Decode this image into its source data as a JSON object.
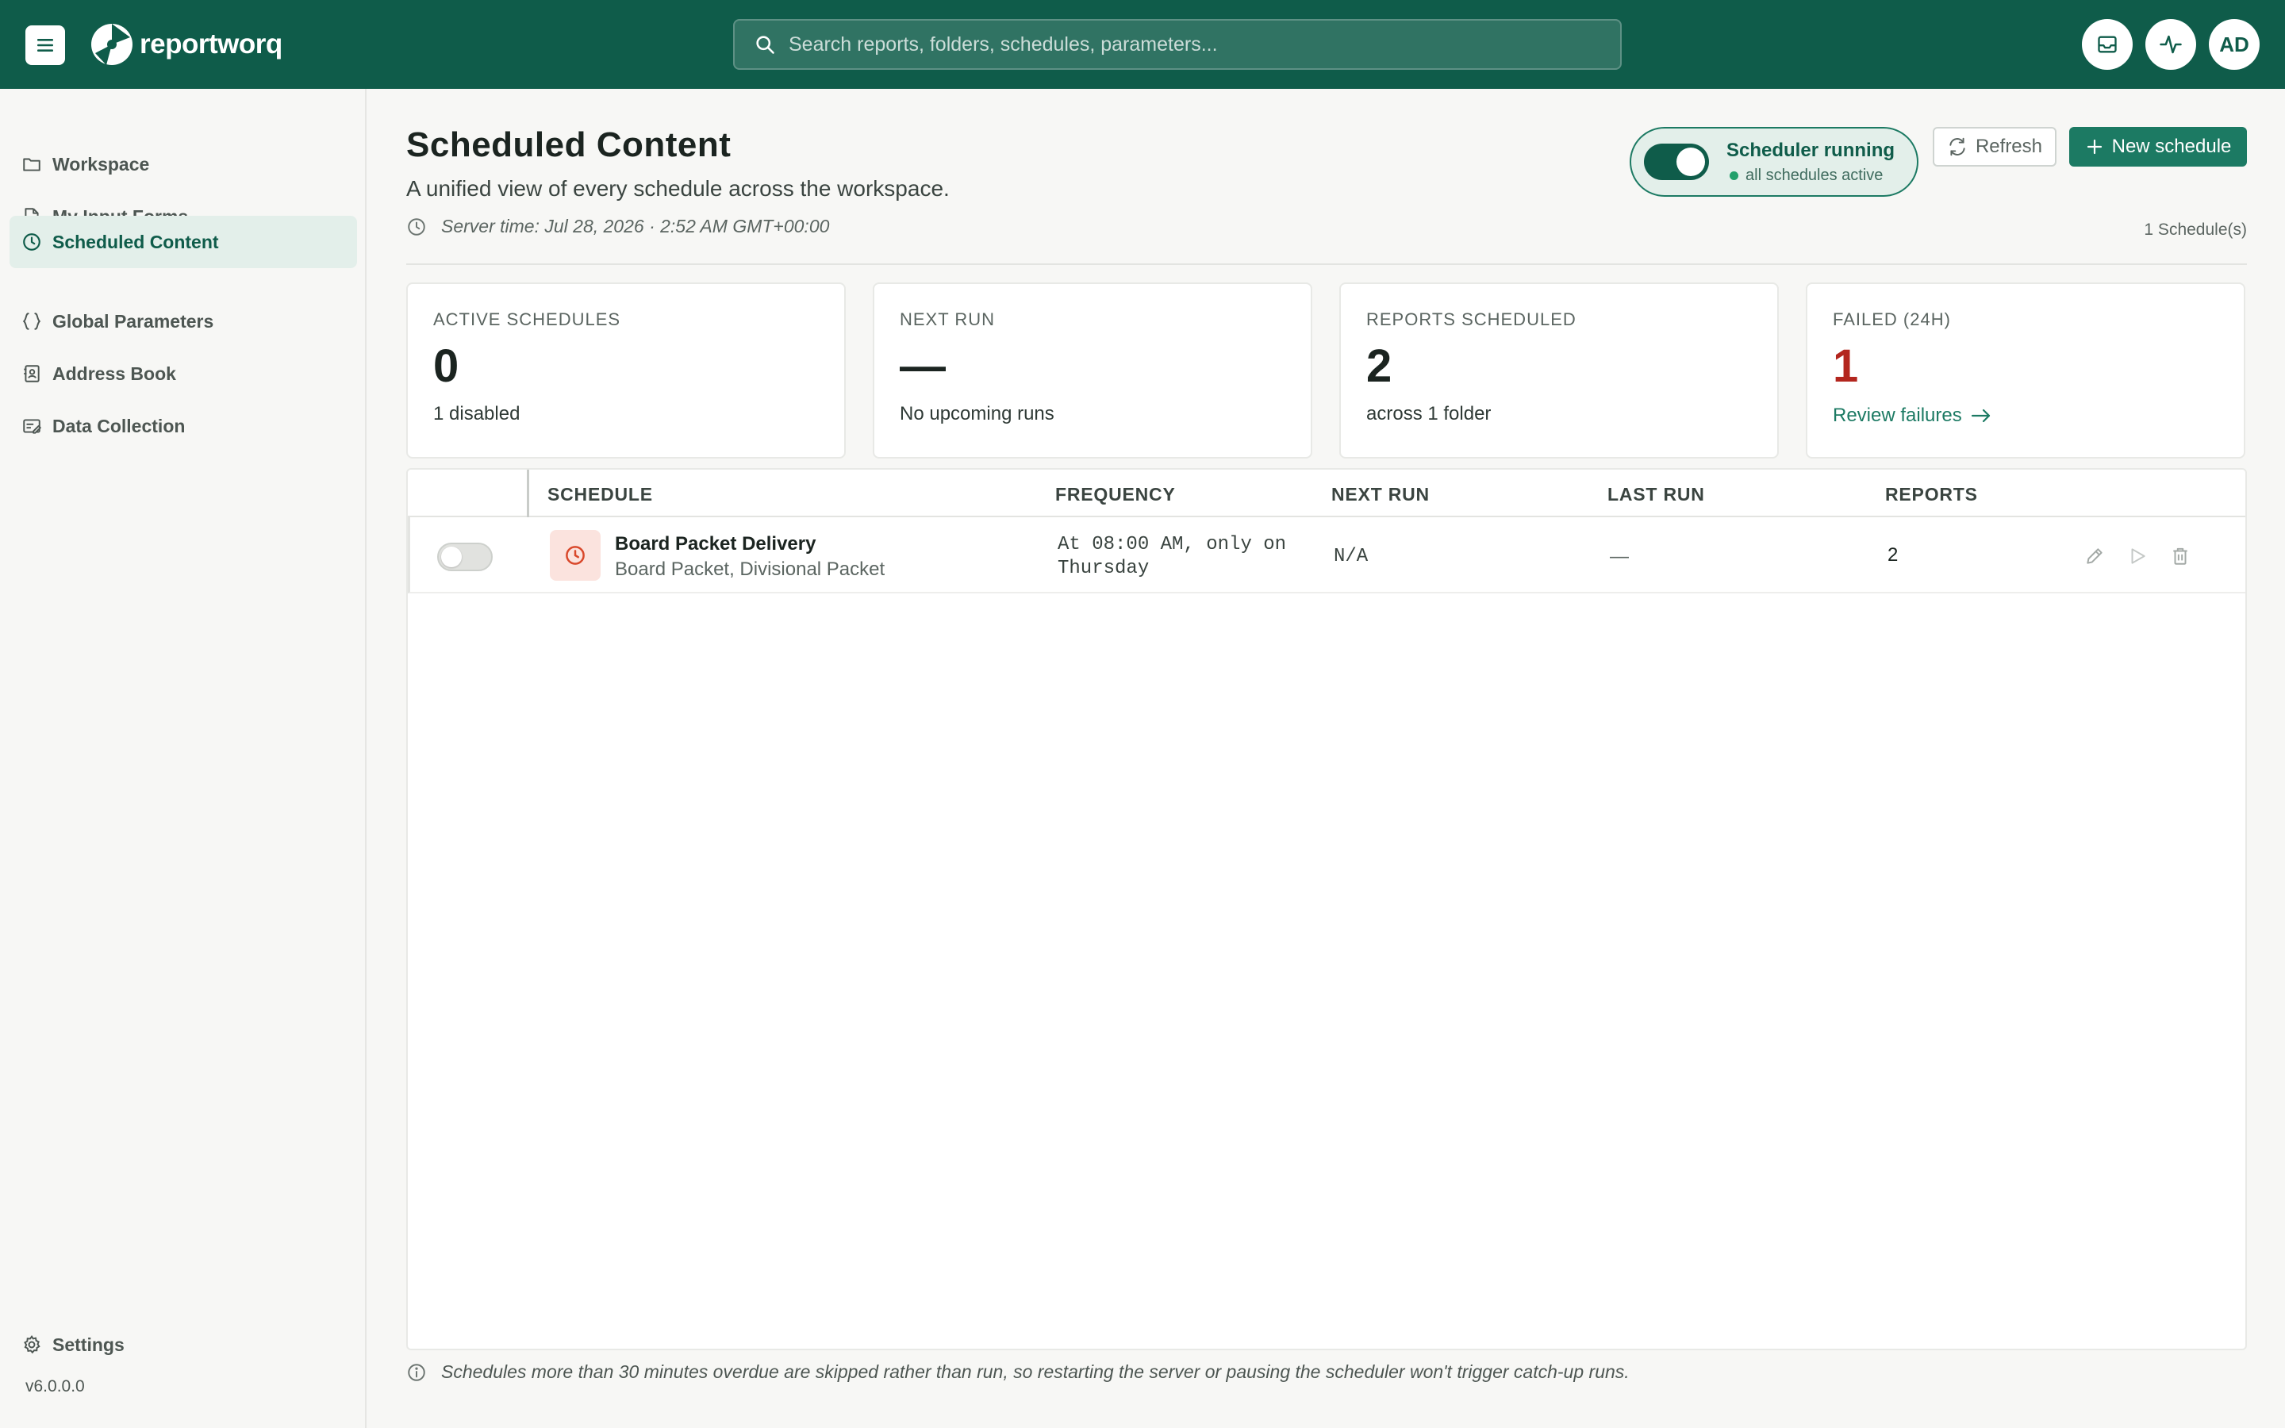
{
  "brand": {
    "name": "reportworq",
    "color": "#0f5c4a",
    "accent": "#1c7a63"
  },
  "search": {
    "placeholder": "Search reports, folders, schedules, parameters..."
  },
  "topbar": {
    "avatar_initials": "AD"
  },
  "sidebar": {
    "items": [
      {
        "label": "Workspace",
        "icon": "folder-icon",
        "active": false
      },
      {
        "label": "My Input Forms",
        "icon": "form-edit-icon",
        "active": false
      },
      {
        "label": "Scheduled Content",
        "icon": "clock-icon",
        "active": true
      },
      {
        "label": "Global Parameters",
        "icon": "braces-icon",
        "active": false
      },
      {
        "label": "Address Book",
        "icon": "contact-book-icon",
        "active": false
      },
      {
        "label": "Data Collection",
        "icon": "data-collection-icon",
        "active": false
      }
    ],
    "settings_label": "Settings",
    "version": "v6.0.0.0"
  },
  "page": {
    "title": "Scheduled Content",
    "subtitle": "A unified view of every schedule across the workspace.",
    "server_time": "Server time: Jul 28, 2026 · 2:52 AM GMT+00:00",
    "schedule_count": "1 Schedule(s)"
  },
  "scheduler": {
    "title": "Scheduler running",
    "status": "all schedules active",
    "enabled": true
  },
  "actions": {
    "refresh_label": "Refresh",
    "new_schedule_label": "New schedule"
  },
  "stats": [
    {
      "label": "ACTIVE SCHEDULES",
      "value": "0",
      "sub": "1 disabled"
    },
    {
      "label": "NEXT RUN",
      "value": "—",
      "sub": "No upcoming runs"
    },
    {
      "label": "REPORTS SCHEDULED",
      "value": "2",
      "sub": "across 1 folder"
    },
    {
      "label": "FAILED (24H)",
      "value": "1",
      "link": "Review failures",
      "color": "#b3261e"
    }
  ],
  "table": {
    "headers": {
      "schedule": "SCHEDULE",
      "frequency": "FREQUENCY",
      "next_run": "NEXT RUN",
      "last_run": "LAST RUN",
      "reports": "REPORTS"
    },
    "rows": [
      {
        "enabled": false,
        "name": "Board Packet Delivery",
        "reports_list": "Board Packet, Divisional Packet",
        "frequency": "At 08:00 AM, only on Thursday",
        "next_run": "N/A",
        "last_run": "—",
        "reports": "2"
      }
    ]
  },
  "footnote": "Schedules more than 30 minutes overdue are skipped rather than run, so restarting the server or pausing the scheduler won't trigger catch-up runs."
}
